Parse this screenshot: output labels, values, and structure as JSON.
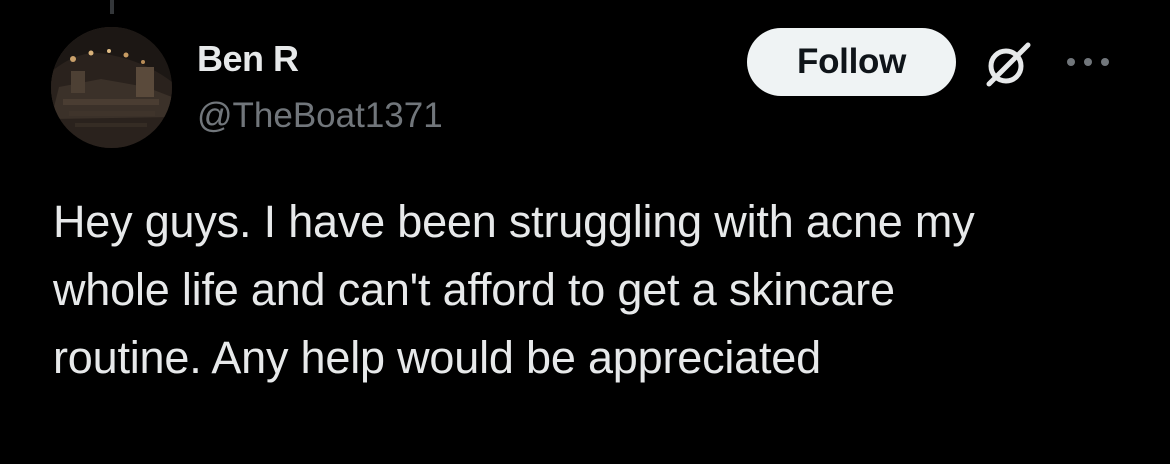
{
  "tweet": {
    "author": {
      "display_name": "Ben R",
      "handle": "@TheBoat1371",
      "avatar_icon": "avatar-photo"
    },
    "actions": {
      "follow_label": "Follow",
      "grok_icon": "grok-icon",
      "more_icon": "more-icon"
    },
    "text": "Hey guys. I have been struggling with acne my\nwhole life and can't afford to get a skincare\nroutine. Any help would be appreciated"
  },
  "colors": {
    "background": "#000000",
    "primary_text": "#e7e9ea",
    "secondary_text": "#71767b",
    "follow_button_bg": "#eff3f4",
    "follow_button_text": "#0f1419"
  }
}
